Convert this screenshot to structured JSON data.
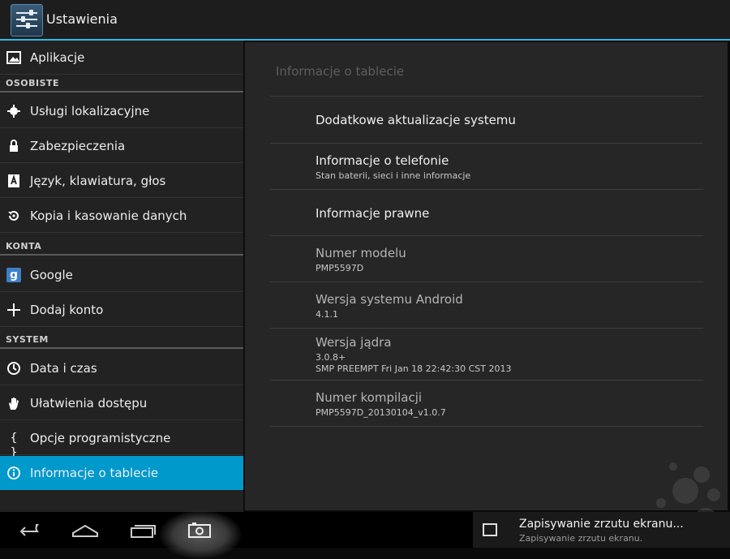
{
  "header": {
    "title": "Ustawienia",
    "icon": "settings-sliders-icon"
  },
  "sidebar": {
    "top_item": {
      "label": "Aplikacje",
      "icon": "image-icon"
    },
    "sections": [
      {
        "title": "OSOBISTE",
        "items": [
          {
            "label": "Usługi lokalizacyjne",
            "icon": "location-icon"
          },
          {
            "label": "Zabezpieczenia",
            "icon": "lock-icon"
          },
          {
            "label": "Język, klawiatura, głos",
            "icon": "keyboard-icon"
          },
          {
            "label": "Kopia i kasowanie danych",
            "icon": "backup-restore-icon"
          }
        ]
      },
      {
        "title": "KONTA",
        "items": [
          {
            "label": "Google",
            "icon": "google-icon"
          },
          {
            "label": "Dodaj konto",
            "icon": "plus-icon"
          }
        ]
      },
      {
        "title": "SYSTEM",
        "items": [
          {
            "label": "Data i czas",
            "icon": "clock-icon"
          },
          {
            "label": "Ułatwienia dostępu",
            "icon": "hand-icon"
          },
          {
            "label": "Opcje programistyczne",
            "icon": "braces-icon"
          },
          {
            "label": "Informacje o tablecie",
            "icon": "info-icon",
            "selected": true
          }
        ]
      }
    ]
  },
  "main": {
    "title": "Informacje o tablecie",
    "rows": [
      {
        "title": "Dodatkowe aktualizacje systemu"
      },
      {
        "title": "Informacje o telefonie",
        "summary": "Stan baterii, sieci i inne informacje"
      },
      {
        "title": "Informacje prawne"
      },
      {
        "title": "Numer modelu",
        "summary": "PMP5597D"
      },
      {
        "title": "Wersja systemu Android",
        "summary": "4.1.1"
      },
      {
        "title": "Wersja jądra",
        "summary": "3.0.8+",
        "summary2": "SMP PREEMPT Fri Jan 18 22:42:30 CST 2013"
      },
      {
        "title": "Numer kompilacji",
        "summary": "PMP5597D_20130104_v1.0.7"
      }
    ]
  },
  "navbar": {
    "buttons": [
      "back-icon",
      "home-icon",
      "recent-apps-icon",
      "screenshot-camera-icon"
    ]
  },
  "notification": {
    "title": "Zapisywanie zrzutu ekranu...",
    "subtitle": "Zapisywanie zrzutu ekranu."
  },
  "colors": {
    "accent": "#33b5e5",
    "selected": "#0099cc"
  }
}
